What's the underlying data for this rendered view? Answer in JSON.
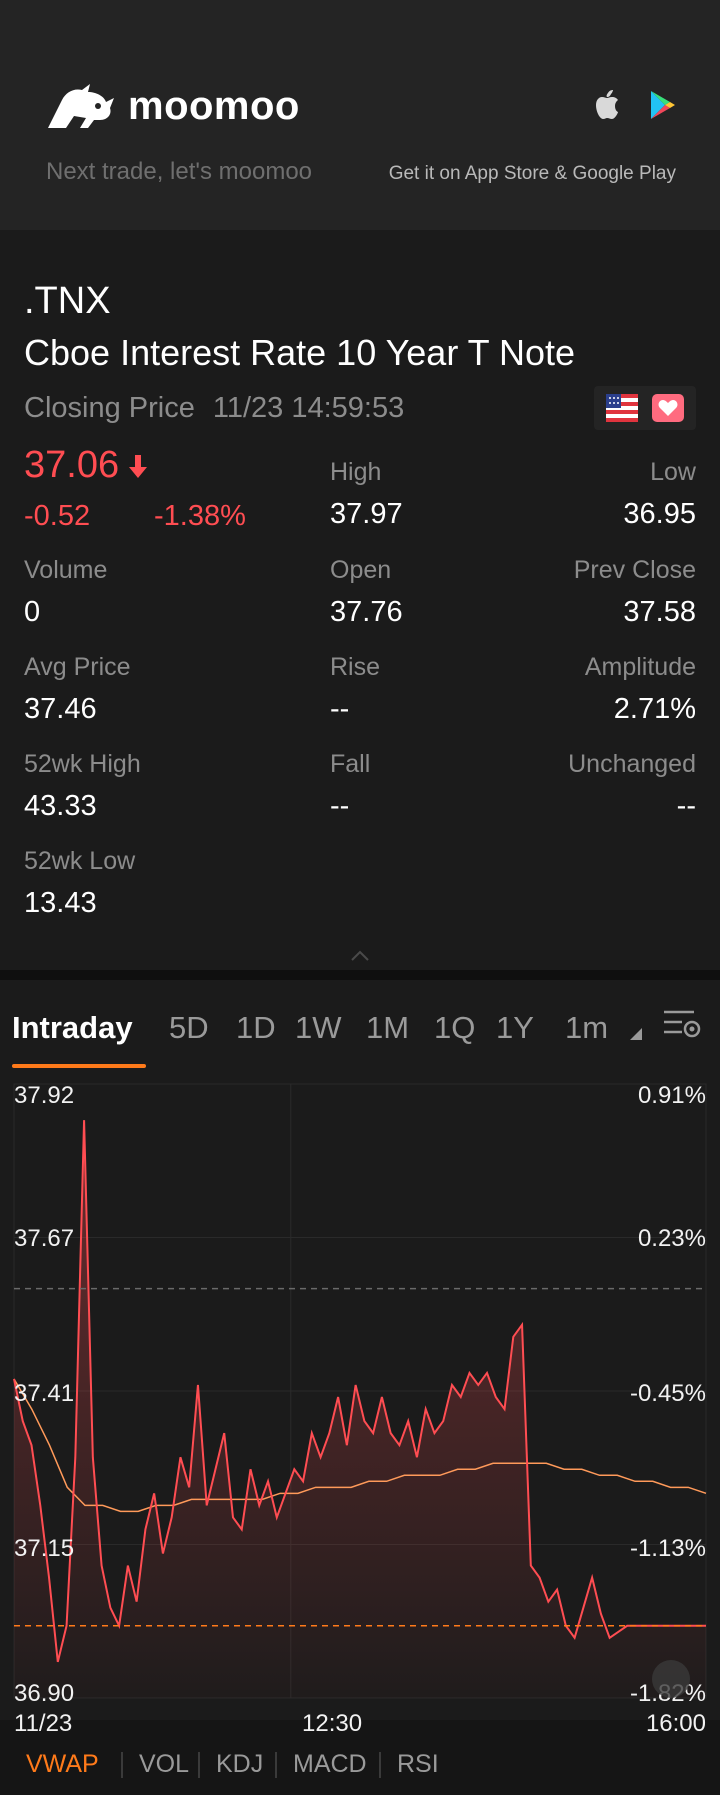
{
  "banner": {
    "brand": "moomoo",
    "tagline": "Next trade, let's moomoo",
    "store_text": "Get it on App Store & Google Play",
    "icons": [
      "apple-icon",
      "google-play-icon"
    ]
  },
  "quote": {
    "ticker": ".TNX",
    "name": "Cboe Interest Rate 10 Year T Note",
    "status": "Closing Price",
    "timestamp": "11/23 14:59:53",
    "price": "37.06",
    "change": "-0.52",
    "change_pct": "-1.38%",
    "colors": {
      "down": "#ff4d52",
      "accent": "#ff7a1a"
    }
  },
  "stats": {
    "high_label": "High",
    "high": "37.97",
    "low_label": "Low",
    "low": "36.95",
    "volume_label": "Volume",
    "volume": "0",
    "open_label": "Open",
    "open": "37.76",
    "prev_close_label": "Prev Close",
    "prev_close": "37.58",
    "avg_price_label": "Avg Price",
    "avg_price": "37.46",
    "rise_label": "Rise",
    "rise": "--",
    "amplitude_label": "Amplitude",
    "amplitude": "2.71%",
    "wk52_high_label": "52wk High",
    "wk52_high": "43.33",
    "fall_label": "Fall",
    "fall": "--",
    "unchanged_label": "Unchanged",
    "unchanged": "--",
    "wk52_low_label": "52wk Low",
    "wk52_low": "13.43"
  },
  "tabs": {
    "intraday": "Intraday",
    "d5": "5D",
    "d1": "1D",
    "w1": "1W",
    "m1": "1M",
    "q1": "1Q",
    "y1": "1Y",
    "interval": "1m",
    "active": "Intraday"
  },
  "chart": {
    "y_left": [
      "37.92",
      "37.67",
      "37.41",
      "37.15",
      "36.90"
    ],
    "y_right": [
      "0.91%",
      "0.23%",
      "-0.45%",
      "-1.13%",
      "-1.82%"
    ],
    "x_labels": [
      "11/23",
      "12:30",
      "16:00"
    ]
  },
  "chart_data": {
    "type": "line",
    "x_range": [
      "11/23 09:30",
      "16:00"
    ],
    "ylim": [
      36.9,
      37.92
    ],
    "prev_close": 37.58,
    "series": [
      {
        "name": "",
        "values": [
          37.43,
          37.36,
          37.32,
          37.22,
          37.1,
          36.96,
          37.02,
          37.3,
          37.86,
          37.3,
          37.12,
          37.05,
          37.02,
          37.12,
          37.06,
          37.18,
          37.24,
          37.14,
          37.2,
          37.3,
          37.25,
          37.42,
          37.22,
          37.28,
          37.34,
          37.2,
          37.18,
          37.28,
          37.22,
          37.26,
          37.2,
          37.24,
          37.28,
          37.26,
          37.34,
          37.3,
          37.34,
          37.4,
          37.32,
          37.42,
          37.36,
          37.34,
          37.4,
          37.34,
          37.32,
          37.36,
          37.3,
          37.38,
          37.34,
          37.36,
          37.42,
          37.4,
          37.44,
          37.42,
          37.44,
          37.4,
          37.38,
          37.5,
          37.52,
          37.12,
          37.1,
          37.06,
          37.08,
          37.02,
          37.0,
          37.05,
          37.1,
          37.04,
          37.0,
          37.01,
          37.02,
          37.02,
          37.02,
          37.02,
          37.02,
          37.02,
          37.02,
          37.02,
          37.02,
          37.02
        ]
      },
      {
        "name": "VWAP",
        "values": [
          37.43,
          37.38,
          37.32,
          37.25,
          37.22,
          37.22,
          37.21,
          37.21,
          37.22,
          37.22,
          37.23,
          37.23,
          37.23,
          37.23,
          37.23,
          37.24,
          37.24,
          37.25,
          37.25,
          37.25,
          37.26,
          37.26,
          37.27,
          37.27,
          37.27,
          37.28,
          37.28,
          37.29,
          37.29,
          37.29,
          37.29,
          37.28,
          37.28,
          37.27,
          37.27,
          37.26,
          37.26,
          37.25,
          37.25,
          37.24
        ]
      }
    ]
  },
  "indicators": [
    "VWAP",
    "VOL",
    "KDJ",
    "MACD",
    "RSI"
  ],
  "indicator_active": "VWAP"
}
